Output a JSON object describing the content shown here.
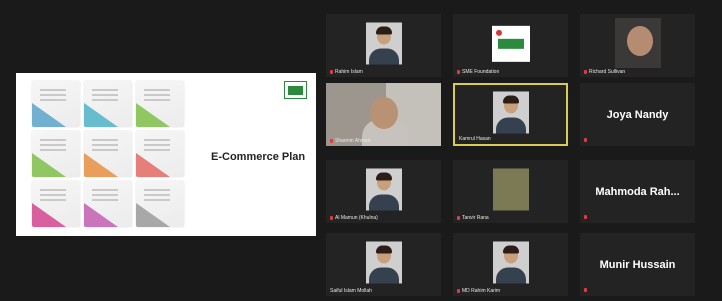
{
  "presentation": {
    "slide_title": "E-Commerce Plan",
    "logo": "sme-logo",
    "doc_colors": [
      "#5aa6c9",
      "#4fb3c7",
      "#7fbf4a",
      "#7fbf4a",
      "#e98f42",
      "#e46a64",
      "#d6458f",
      "#c35fb2",
      "#9b9b9b"
    ]
  },
  "participants": [
    {
      "id": "p1",
      "name": "Rahim Islam",
      "video": true,
      "muted": true
    },
    {
      "id": "p2",
      "name": "SME Foundation",
      "video": true,
      "muted": true
    },
    {
      "id": "p3",
      "name": "Richard Sullivan",
      "video": true,
      "muted": true
    },
    {
      "id": "p4",
      "name": "Sharmin Ahmed",
      "video": true,
      "muted": true
    },
    {
      "id": "p5",
      "name": "Kamrul Hasan",
      "video": true,
      "muted": false,
      "active": true
    },
    {
      "id": "p6",
      "name": "Joya Nandy",
      "video": false,
      "muted": true
    },
    {
      "id": "p7",
      "name": "Al Mamun (Khulna)",
      "video": true,
      "muted": true
    },
    {
      "id": "p8",
      "name": "Tanvir Rana",
      "video": true,
      "muted": true
    },
    {
      "id": "p9",
      "name": "Mahmoda Rah...",
      "video": false,
      "muted": true
    },
    {
      "id": "p10",
      "name": "Saiful Islam Mollah",
      "video": true,
      "muted": false
    },
    {
      "id": "p11",
      "name": "MD Rahim Karim",
      "video": true,
      "muted": true
    },
    {
      "id": "p12",
      "name": "Munir Hussain",
      "video": false,
      "muted": true
    }
  ]
}
